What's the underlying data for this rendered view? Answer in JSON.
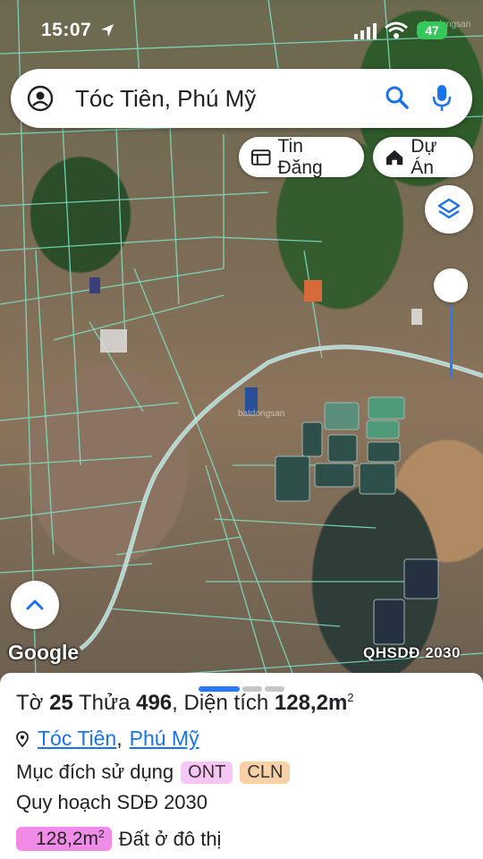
{
  "status_bar": {
    "time": "15:07",
    "battery": "47"
  },
  "search": {
    "query": "Tóc Tiên, Phú Mỹ"
  },
  "chips": [
    {
      "label": "Tin Đăng",
      "icon": "listing-icon"
    },
    {
      "label": "Dự Án",
      "icon": "house-icon"
    }
  ],
  "map": {
    "attribution": "Google",
    "planning_layer": "QHSDĐ 2030",
    "watermark": "batdongsan",
    "layer_opacity": 0.85
  },
  "sheet": {
    "title": {
      "sheet_label": "Tờ",
      "sheet_no": "25",
      "parcel_label": "Thửa",
      "parcel_no": "496",
      "area_label": "Diện tích",
      "area_value": "128,2m",
      "area_sup": "2"
    },
    "location": {
      "commune": "Tóc Tiên",
      "town": "Phú Mỹ"
    },
    "purpose_label": "Mục đích sử dụng",
    "purpose_tags": [
      "ONT",
      "CLN"
    ],
    "planning_label": "Quy hoạch SDĐ 2030",
    "area_value": "128,2m",
    "area_sup": "2",
    "area_desc": "Đất ở đô thị"
  },
  "colors": {
    "accent": "#1a73e8",
    "tag_ont": "#f7c6f5",
    "tag_cln": "#f8d2a6",
    "area_badge": "#f08ce8",
    "parcel_lines": "#7fe3c8"
  }
}
